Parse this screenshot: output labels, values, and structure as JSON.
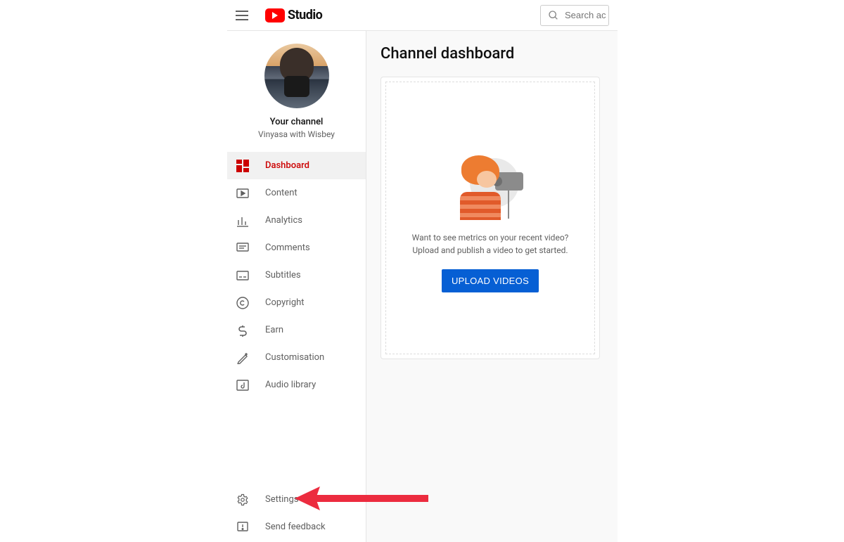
{
  "header": {
    "logo_text": "Studio",
    "search_placeholder": "Search ac"
  },
  "profile": {
    "title": "Your channel",
    "name": "Vinyasa with Wisbey"
  },
  "nav": {
    "items": [
      {
        "label": "Dashboard",
        "icon": "dashboard",
        "active": true
      },
      {
        "label": "Content",
        "icon": "content"
      },
      {
        "label": "Analytics",
        "icon": "analytics"
      },
      {
        "label": "Comments",
        "icon": "comments"
      },
      {
        "label": "Subtitles",
        "icon": "subtitles"
      },
      {
        "label": "Copyright",
        "icon": "copyright"
      },
      {
        "label": "Earn",
        "icon": "earn"
      },
      {
        "label": "Customisation",
        "icon": "customise"
      },
      {
        "label": "Audio library",
        "icon": "audio"
      }
    ],
    "bottom": [
      {
        "label": "Settings",
        "icon": "settings"
      },
      {
        "label": "Send feedback",
        "icon": "feedback"
      }
    ]
  },
  "main": {
    "title": "Channel dashboard",
    "prompt_line1": "Want to see metrics on your recent video?",
    "prompt_line2": "Upload and publish a video to get started.",
    "upload_button": "UPLOAD VIDEOS"
  }
}
